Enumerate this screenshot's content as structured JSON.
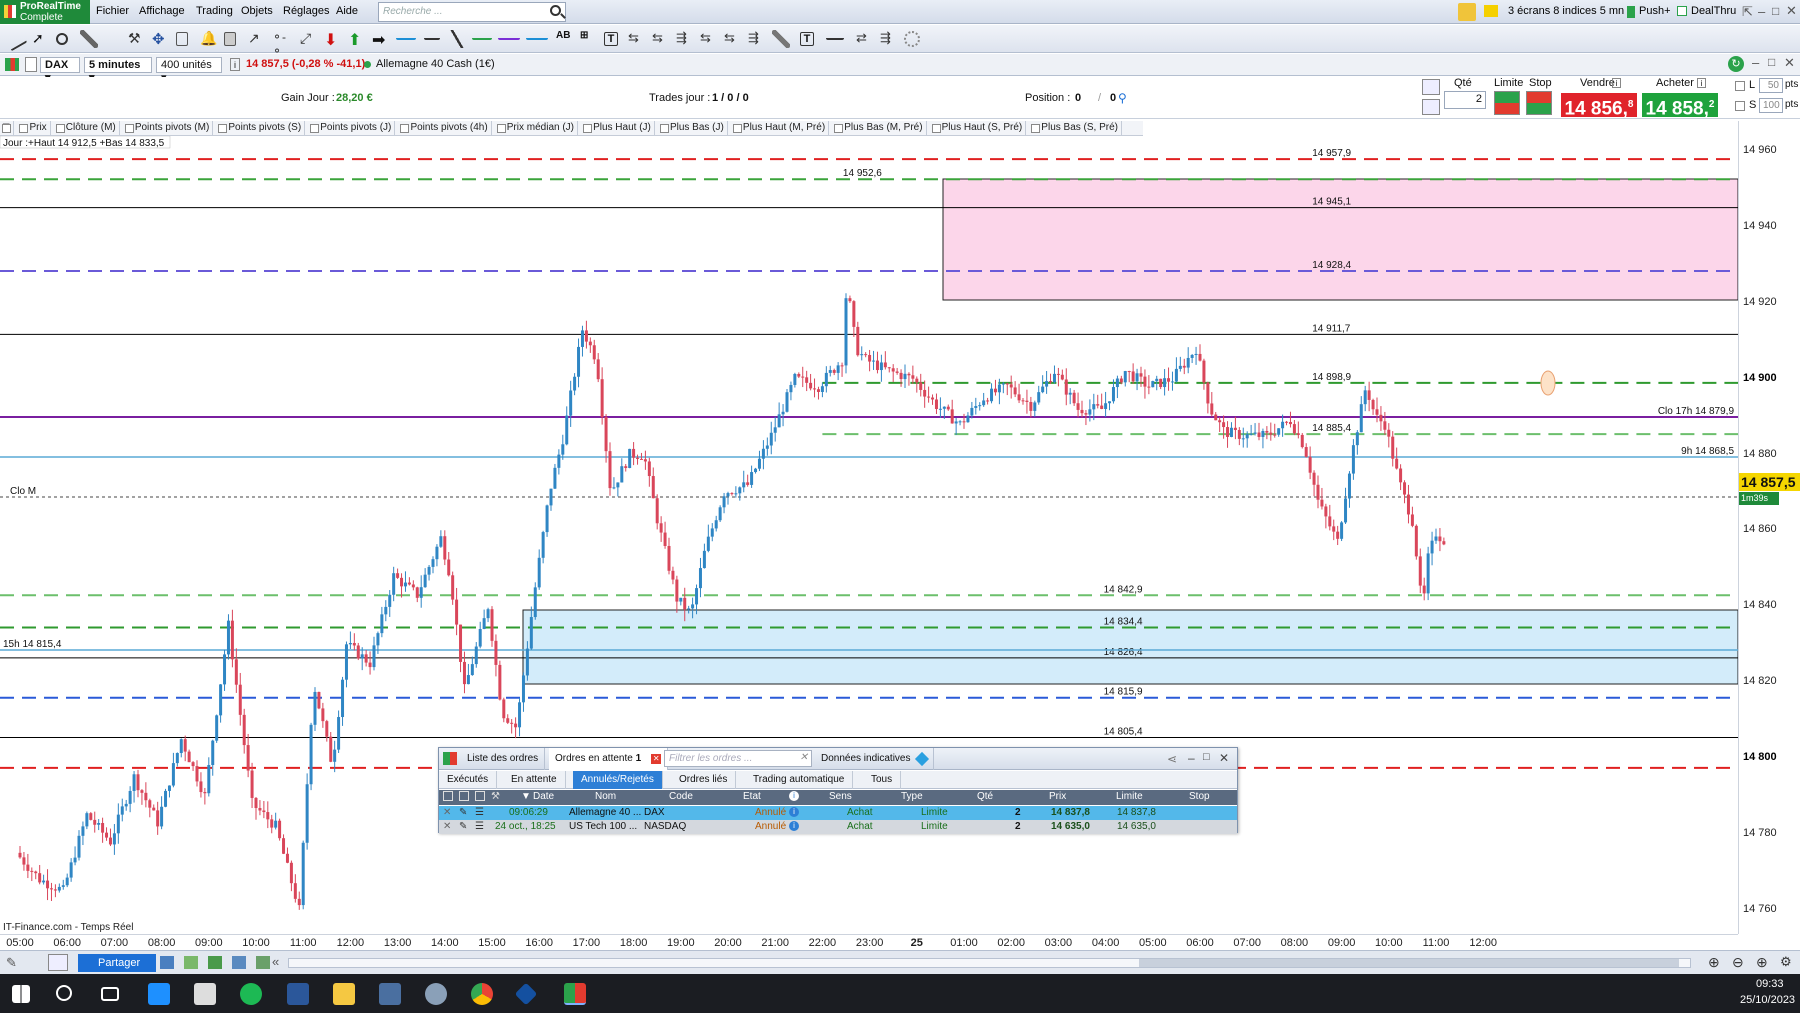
{
  "app": {
    "logo_line1": "ProRealTime",
    "logo_line2": "Complete"
  },
  "menu": [
    "Fichier",
    "Affichage",
    "Trading",
    "Objets",
    "Réglages",
    "Aide"
  ],
  "search_placeholder": "Recherche ...",
  "topright": {
    "screens": "3 écrans 8 indices 5 mn",
    "push": "Push+",
    "dealthru": "DealThru"
  },
  "instrument": {
    "symbol": "DAX",
    "interval": "5 minutes",
    "units": "400 unités",
    "quote": "14 857,5 (-0,28 % -41,1)",
    "market": "Allemagne 40 Cash (1€)"
  },
  "tradebar": {
    "gain_label": "Gain Jour :",
    "gain_value": "28,20 €",
    "trades_label": "Trades jour :",
    "trades_value": "1 / 0 / 0",
    "position_label": "Position :",
    "position_value": "0",
    "position_value2": "0",
    "qty_label": "Qté",
    "qty_value": "2",
    "limit_label": "Limite",
    "stop_label": "Stop",
    "sell_label": "Vendre",
    "buy_label": "Acheter",
    "sell_price": "14 856,",
    "sell_sup": "8",
    "buy_price": "14 858,",
    "buy_sup": "2",
    "l_label": "L",
    "s_label": "S",
    "l_pts": "50",
    "s_pts": "100",
    "pts": "pts"
  },
  "indicators": [
    "Prix",
    "Clôture (M)",
    "Points pivots (M)",
    "Points pivots (S)",
    "Points pivots (J)",
    "Points pivots (4h)",
    "Prix médian (J)",
    "Plus Haut (J)",
    "Plus Bas (J)",
    "Plus Haut (M, Pré)",
    "Plus Bas (M, Pré)",
    "Plus Haut (S, Pré)",
    "Plus Bas (S, Pré)"
  ],
  "chart_info": {
    "day": "Jour :+Haut 14 912,5 +Bas 14 833,5",
    "clo_m": "Clo M",
    "h15": "15h 14 815,4",
    "clo17": "Clo 17h 14 879,9",
    "h9": "9h 14 868,5",
    "watermark": "IT-Finance.com - Temps Réel",
    "last_price": "14 857,5",
    "countdown": "1m39s"
  },
  "levels": [
    {
      "label": "14 957,9",
      "price": 14957.9,
      "color": "#e02020",
      "dash": "dash",
      "lx": 0.755
    },
    {
      "label": "14 952,6",
      "price": 14952.6,
      "color": "#3aa43a",
      "dash": "dash",
      "lx": 0.485
    },
    {
      "label": "14 945,1",
      "price": 14945.1,
      "color": "#000000",
      "dash": "none",
      "lx": 0.755
    },
    {
      "label": "14 928,4",
      "price": 14928.4,
      "color": "#6a5ad8",
      "dash": "dash",
      "lx": 0.755
    },
    {
      "label": "14 911,7",
      "price": 14911.7,
      "color": "#000000",
      "dash": "none",
      "lx": 0.755
    },
    {
      "label": "14 898,9",
      "price": 14898.9,
      "color": "#2f9a2f",
      "dash": "dash",
      "lx": 0.755
    },
    {
      "label": "14 885,4",
      "price": 14885.4,
      "color": "#6cbf6c",
      "dash": "dash",
      "lx": 0.755
    },
    {
      "label": "14 842,9",
      "price": 14842.9,
      "color": "#6cbf6c",
      "dash": "dash",
      "lx": 0.635
    },
    {
      "label": "14 834,4",
      "price": 14834.4,
      "color": "#2f9a2f",
      "dash": "dash",
      "lx": 0.635
    },
    {
      "label": "14 826,4",
      "price": 14826.4,
      "color": "#000000",
      "dash": "none",
      "lx": 0.635
    },
    {
      "label": "14 815,9",
      "price": 14815.9,
      "color": "#2a5ad8",
      "dash": "dash",
      "lx": 0.635
    },
    {
      "label": "14 805,4",
      "price": 14805.4,
      "color": "#000000",
      "dash": "none",
      "lx": 0.635
    },
    {
      "label": "14 797,4",
      "price": 14797.4,
      "color": "#e02020",
      "dash": "dash",
      "lx": 0.635
    }
  ],
  "price_ticks": [
    {
      "label": "14 960",
      "price": 14960,
      "bold": false
    },
    {
      "label": "14 940",
      "price": 14940,
      "bold": false
    },
    {
      "label": "14 920",
      "price": 14920,
      "bold": false
    },
    {
      "label": "14 900",
      "price": 14900,
      "bold": true
    },
    {
      "label": "14 880",
      "price": 14880,
      "bold": false
    },
    {
      "label": "14 860",
      "price": 14860,
      "bold": false
    },
    {
      "label": "14 840",
      "price": 14840,
      "bold": false
    },
    {
      "label": "14 820",
      "price": 14820,
      "bold": false
    },
    {
      "label": "14 800",
      "price": 14800,
      "bold": true
    },
    {
      "label": "14 780",
      "price": 14780,
      "bold": false
    },
    {
      "label": "14 760",
      "price": 14760,
      "bold": false
    }
  ],
  "time_ticks": [
    "05:00",
    "06:00",
    "07:00",
    "08:00",
    "09:00",
    "10:00",
    "11:00",
    "12:00",
    "13:00",
    "14:00",
    "15:00",
    "16:00",
    "17:00",
    "18:00",
    "19:00",
    "20:00",
    "21:00",
    "22:00",
    "23:00",
    "25",
    "01:00",
    "02:00",
    "03:00",
    "04:00",
    "05:00",
    "06:00",
    "07:00",
    "08:00",
    "09:00",
    "10:00",
    "11:00",
    "12:00"
  ],
  "price_path": [
    [
      0,
      14775
    ],
    [
      0.5,
      14768
    ],
    [
      1,
      14765
    ],
    [
      1.5,
      14785
    ],
    [
      2,
      14778
    ],
    [
      2.5,
      14795
    ],
    [
      3,
      14783
    ],
    [
      3.5,
      14805
    ],
    [
      4,
      14790
    ],
    [
      4.5,
      14835
    ],
    [
      5,
      14788
    ],
    [
      5.5,
      14782
    ],
    [
      6,
      14760
    ],
    [
      6.3,
      14820
    ],
    [
      6.7,
      14798
    ],
    [
      7,
      14830
    ],
    [
      7.5,
      14825
    ],
    [
      8,
      14848
    ],
    [
      8.5,
      14843
    ],
    [
      9,
      14858
    ],
    [
      9.2,
      14848
    ],
    [
      9.5,
      14818
    ],
    [
      10,
      14840
    ],
    [
      10.3,
      14812
    ],
    [
      10.6,
      14808
    ],
    [
      11,
      14845
    ],
    [
      11.3,
      14870
    ],
    [
      11.6,
      14885
    ],
    [
      12,
      14913
    ],
    [
      12.3,
      14905
    ],
    [
      12.6,
      14870
    ],
    [
      13,
      14880
    ],
    [
      13.3,
      14880
    ],
    [
      13.6,
      14862
    ],
    [
      14,
      14842
    ],
    [
      14.3,
      14838
    ],
    [
      14.6,
      14855
    ],
    [
      15,
      14870
    ],
    [
      15.5,
      14872
    ],
    [
      16,
      14885
    ],
    [
      16.5,
      14900
    ],
    [
      17,
      14898
    ],
    [
      17.5,
      14905
    ],
    [
      17.6,
      14925
    ],
    [
      17.8,
      14908
    ],
    [
      18,
      14905
    ],
    [
      18.5,
      14902
    ],
    [
      19,
      14900
    ],
    [
      19.5,
      14893
    ],
    [
      20,
      14888
    ],
    [
      20.5,
      14895
    ],
    [
      21,
      14898
    ],
    [
      21.5,
      14893
    ],
    [
      22,
      14902
    ],
    [
      22.5,
      14892
    ],
    [
      23,
      14892
    ],
    [
      23.5,
      14902
    ],
    [
      24,
      14898
    ],
    [
      24.5,
      14900
    ],
    [
      25,
      14908
    ],
    [
      25.3,
      14892
    ],
    [
      25.6,
      14886
    ],
    [
      26,
      14885
    ],
    [
      26.5,
      14885
    ],
    [
      27,
      14889
    ],
    [
      27.3,
      14882
    ],
    [
      27.6,
      14867
    ],
    [
      28,
      14857
    ],
    [
      28.3,
      14880
    ],
    [
      28.6,
      14898
    ],
    [
      28.8,
      14890
    ],
    [
      29,
      14888
    ],
    [
      29.3,
      14873
    ],
    [
      29.6,
      14862
    ],
    [
      29.8,
      14838
    ],
    [
      29.9,
      14852
    ],
    [
      30,
      14856
    ],
    [
      30.1,
      14860
    ],
    [
      30.2,
      14857.5
    ]
  ],
  "orders": {
    "tabs": [
      "Liste des ordres",
      "Ordres en attente",
      "Données indicatives"
    ],
    "pending_count": "1",
    "filter_placeholder": "Filtrer les ordres ...",
    "subtabs": [
      "Exécutés",
      "En attente",
      "Annulés/Rejetés",
      "Ordres liés",
      "Trading automatique",
      "Tous"
    ],
    "headers": [
      "Date",
      "Nom",
      "Code",
      "Etat",
      "Sens",
      "Type",
      "Qté",
      "Prix",
      "Limite",
      "Stop"
    ],
    "rows": [
      {
        "date": "09:06:29",
        "name": "Allemagne 40 ...",
        "code": "DAX",
        "state": "Annulé",
        "side": "Achat",
        "type": "Limite",
        "qty": "2",
        "price": "14 837,8",
        "limit": "14 837,8",
        "stop": ""
      },
      {
        "date": "24 oct., 18:25",
        "name": "US Tech 100 ...",
        "code": "NASDAQ",
        "state": "Annulé",
        "side": "Achat",
        "type": "Limite",
        "qty": "2",
        "price": "14 635,0",
        "limit": "14 635,0",
        "stop": ""
      }
    ]
  },
  "bottombar": {
    "share": "Partager"
  },
  "taskbar": {
    "time": "09:33",
    "date": "25/10/2023"
  }
}
